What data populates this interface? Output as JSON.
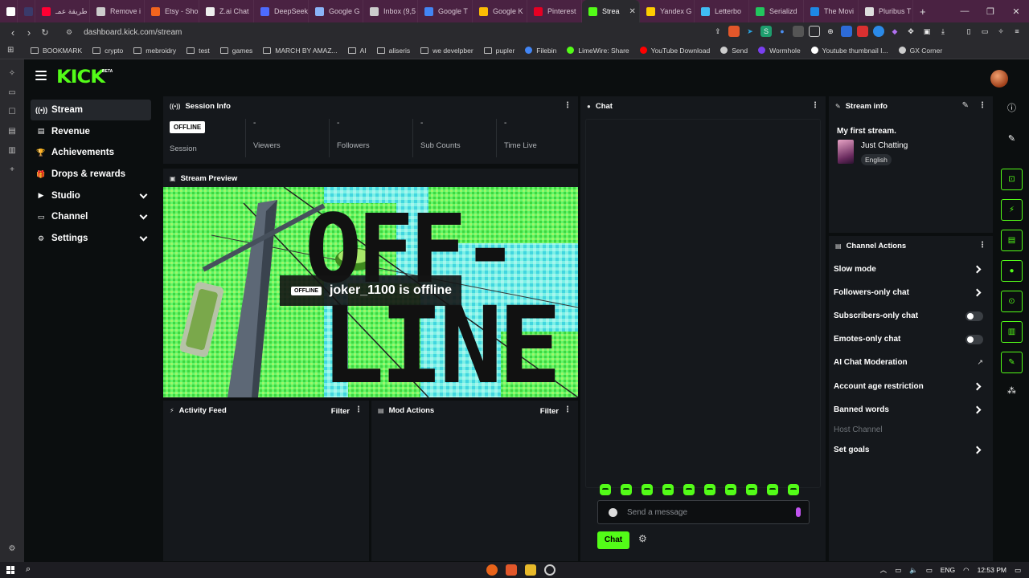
{
  "browser": {
    "tabs": [
      {
        "label": "",
        "color": "#ffffff"
      },
      {
        "label": "",
        "color": "#3a3a6a"
      },
      {
        "label": "طريقة عمـ",
        "color": "#ff0033"
      },
      {
        "label": "Remove i",
        "color": "#cccccc"
      },
      {
        "label": "Etsy - Sho",
        "color": "#f1641e"
      },
      {
        "label": "Z.ai Chat",
        "color": "#eeeeee"
      },
      {
        "label": "DeepSeek",
        "color": "#4d6bfe"
      },
      {
        "label": "Google G",
        "color": "#8ab4f8"
      },
      {
        "label": "Inbox (9,5",
        "color": "#cccccc"
      },
      {
        "label": "Google T",
        "color": "#4285f4"
      },
      {
        "label": "Google K",
        "color": "#fbbc04"
      },
      {
        "label": "Pinterest",
        "color": "#e60023"
      },
      {
        "label": "Strea",
        "color": "#53fc18",
        "active": true
      },
      {
        "label": "Yandex G",
        "color": "#ffcc00"
      },
      {
        "label": "Letterbo",
        "color": "#40bcf4"
      },
      {
        "label": "Serializd",
        "color": "#22c55e"
      },
      {
        "label": "The Movi",
        "color": "#1e88e5"
      },
      {
        "label": "Pluribus T",
        "color": "#dddddd"
      }
    ],
    "url": "dashboard.kick.com/stream",
    "bookmarks": [
      {
        "label": "BOOKMARK",
        "kind": "folder"
      },
      {
        "label": "crypto",
        "kind": "folder"
      },
      {
        "label": "mebroidry",
        "kind": "folder"
      },
      {
        "label": "test",
        "kind": "folder"
      },
      {
        "label": "games",
        "kind": "folder"
      },
      {
        "label": "MARCH BY AMAZ...",
        "kind": "folder"
      },
      {
        "label": "AI",
        "kind": "folder"
      },
      {
        "label": "aliseris",
        "kind": "folder"
      },
      {
        "label": "we develpber",
        "kind": "folder"
      },
      {
        "label": "pupler",
        "kind": "folder"
      },
      {
        "label": "Filebin",
        "kind": "site",
        "color": "#4285f4"
      },
      {
        "label": "LimeWire: Share",
        "kind": "site",
        "color": "#53fc18"
      },
      {
        "label": "YouTube Download",
        "kind": "site",
        "color": "#ff0000"
      },
      {
        "label": "Send",
        "kind": "site",
        "color": "#cccccc"
      },
      {
        "label": "Wormhole",
        "kind": "site",
        "color": "#7a3ff0"
      },
      {
        "label": "Youtube thumbnail I...",
        "kind": "site",
        "color": "#ffffff"
      },
      {
        "label": "GX Corner",
        "kind": "site",
        "color": "#cccccc"
      }
    ]
  },
  "app": {
    "logo": "KICK",
    "beta": "BETA",
    "nav": [
      {
        "label": "Stream",
        "icon": "broadcast-icon",
        "glyph": "((•))",
        "active": true,
        "expand": false
      },
      {
        "label": "Revenue",
        "icon": "revenue-icon",
        "glyph": "▤",
        "expand": false
      },
      {
        "label": "Achievements",
        "icon": "trophy-icon",
        "glyph": "🏆",
        "expand": false
      },
      {
        "label": "Drops & rewards",
        "icon": "gift-icon",
        "glyph": "🎁",
        "expand": false
      },
      {
        "label": "Studio",
        "icon": "studio-icon",
        "glyph": "▶",
        "expand": true
      },
      {
        "label": "Channel",
        "icon": "channel-icon",
        "glyph": "▭",
        "expand": true
      },
      {
        "label": "Settings",
        "icon": "gear-icon",
        "glyph": "⚙",
        "expand": true
      }
    ]
  },
  "session": {
    "title": "Session Info",
    "badge": "OFFLINE",
    "session_label": "Session",
    "stats": [
      {
        "label": "Viewers",
        "value": "-"
      },
      {
        "label": "Followers",
        "value": "-"
      },
      {
        "label": "Sub Counts",
        "value": "-"
      },
      {
        "label": "Time Live",
        "value": "-"
      }
    ]
  },
  "preview": {
    "title": "Stream Preview",
    "badge": "OFFLINE",
    "message": "joker_1100 is offline",
    "art_text_top": "OFF-",
    "art_text_bottom": "LINE"
  },
  "activity": {
    "title": "Activity Feed",
    "filter": "Filter"
  },
  "mod_actions": {
    "title": "Mod Actions",
    "filter": "Filter"
  },
  "chat": {
    "title": "Chat",
    "placeholder": "Send a message",
    "send_label": "Chat",
    "emote_count": 10
  },
  "stream_info": {
    "title": "Stream info",
    "stream_title": "My first stream.",
    "category": "Just Chatting",
    "language": "English"
  },
  "channel_actions": {
    "title": "Channel Actions",
    "items": [
      {
        "label": "Slow mode",
        "control": "arrow"
      },
      {
        "label": "Followers-only chat",
        "control": "arrow"
      },
      {
        "label": "Subscribers-only chat",
        "control": "toggle",
        "on": false
      },
      {
        "label": "Emotes-only chat",
        "control": "toggle",
        "on": false
      },
      {
        "label": "AI Chat Moderation",
        "control": "external"
      },
      {
        "label": "Account age restriction",
        "control": "arrow"
      },
      {
        "label": "Banned words",
        "control": "arrow"
      },
      {
        "label": "Host Channel",
        "control": "none",
        "disabled": true
      },
      {
        "label": "Set goals",
        "control": "arrow"
      }
    ]
  },
  "taskbar": {
    "lang": "ENG",
    "time": "12:53 PM"
  },
  "colors": {
    "accent": "#53fc18",
    "panel": "#15181c",
    "bg": "#0b0e0f"
  }
}
